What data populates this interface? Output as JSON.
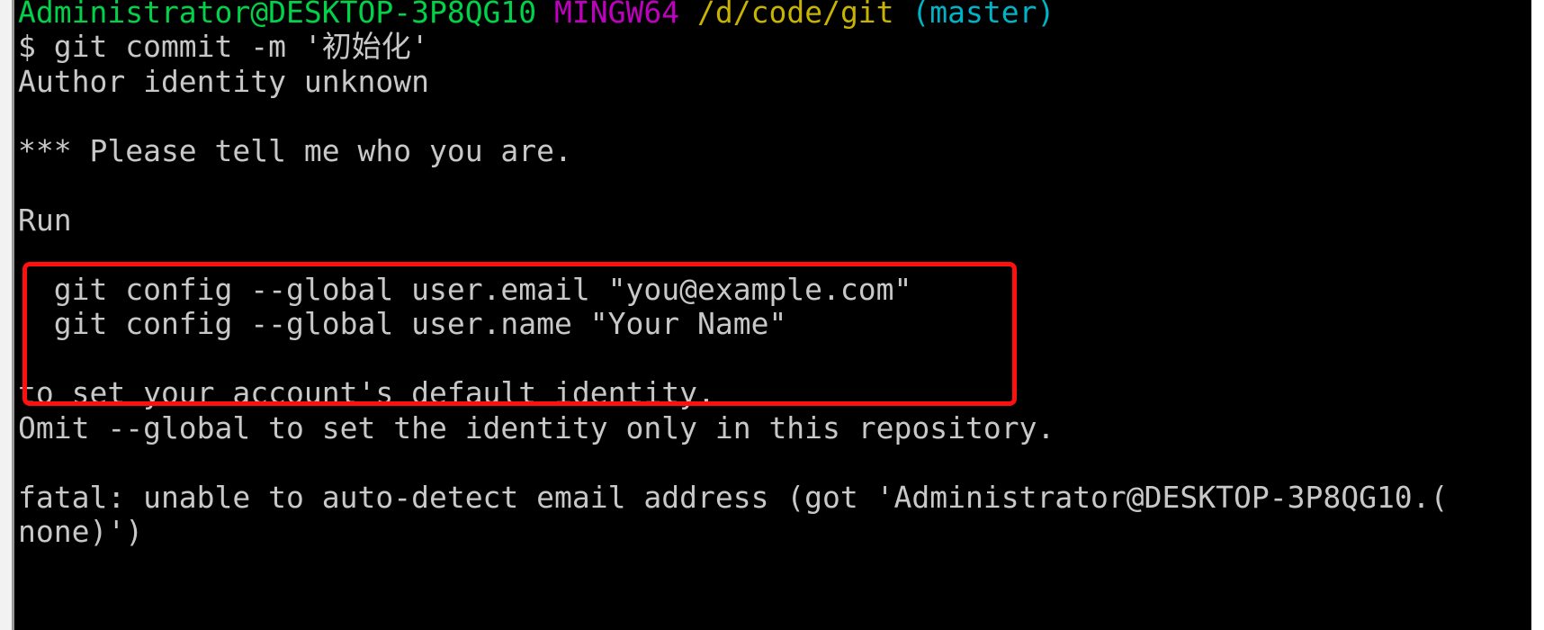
{
  "prompt": {
    "user_host": "Administrator@DESKTOP-3P8QG10",
    "env": "MINGW64",
    "path": "/d/code/git",
    "branch": "(master)"
  },
  "command": "$ git commit -m '初始化'",
  "output": {
    "line1": "Author identity unknown",
    "line2": "*** Please tell me who you are.",
    "line3": "Run",
    "cmd1": "  git config --global user.email \"you@example.com\"",
    "cmd2": "  git config --global user.name \"Your Name\"",
    "line4": "to set your account's default identity.",
    "line5": "Omit --global to set the identity only in this repository.",
    "fatal1": "fatal: unable to auto-detect email address (got 'Administrator@DESKTOP-3P8QG10.(",
    "fatal2": "none)')"
  },
  "colors": {
    "user_host": "#00d24a",
    "env": "#c000c0",
    "path": "#c8b400",
    "branch": "#00b4c8",
    "highlight_box": "#ff1010",
    "background": "#000000"
  }
}
